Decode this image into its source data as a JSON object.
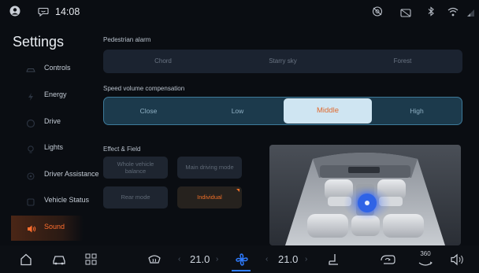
{
  "status": {
    "time": "14:08"
  },
  "sidebar": {
    "title": "Settings",
    "items": [
      {
        "label": "Controls",
        "icon": "car-icon"
      },
      {
        "label": "Energy",
        "icon": "energy-icon"
      },
      {
        "label": "Drive",
        "icon": "steering-icon"
      },
      {
        "label": "Lights",
        "icon": "light-icon"
      },
      {
        "label": "Driver Assistance",
        "icon": "assist-icon"
      },
      {
        "label": "Vehicle Status",
        "icon": "status-icon"
      },
      {
        "label": "Sound",
        "icon": "speaker-icon",
        "active": true
      }
    ]
  },
  "pedestrian": {
    "label": "Pedestrian alarm",
    "options": [
      "Chord",
      "Starry sky",
      "Forest"
    ]
  },
  "speed": {
    "label": "Speed volume compensation",
    "options": [
      "Close",
      "Low",
      "Middle",
      "High"
    ],
    "selected": "Middle"
  },
  "effect": {
    "label": "Effect & Field",
    "buttons": [
      "Whole vehicle balance",
      "Main driving mode",
      "Rear mode",
      "Individual"
    ],
    "active": "Individual"
  },
  "bottom": {
    "temp_left": "21.0",
    "temp_right": "21.0",
    "cam_label": "360"
  },
  "colors": {
    "accent": "#f07028",
    "selection": "#cfe5f2"
  }
}
